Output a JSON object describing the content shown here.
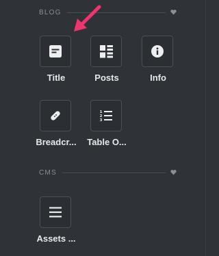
{
  "sections": {
    "blog": {
      "title": "BLOG",
      "items": [
        {
          "label": "Title",
          "icon": "title-widget-icon"
        },
        {
          "label": "Posts",
          "icon": "posts-widget-icon"
        },
        {
          "label": "Info",
          "icon": "info-icon"
        },
        {
          "label": "Breadcr...",
          "icon": "breadcrumb-icon"
        },
        {
          "label": "Table O...",
          "icon": "table-of-contents-icon"
        }
      ]
    },
    "cms": {
      "title": "CMS",
      "items": [
        {
          "label": "Assets ...",
          "icon": "menu-lines-icon"
        }
      ]
    }
  },
  "colors": {
    "background": "#2f3237",
    "accent_arrow": "#f0346f"
  }
}
